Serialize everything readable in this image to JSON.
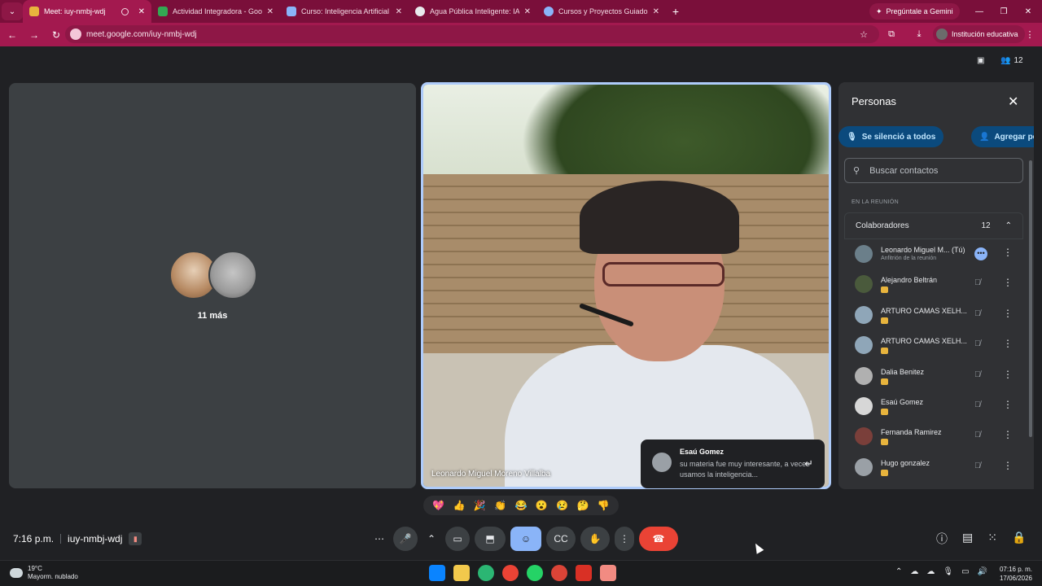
{
  "browser": {
    "tabs": [
      {
        "title": "Meet: iuy-nmbj-wdj",
        "active": true,
        "favicon_color": "#e8b43d"
      },
      {
        "title": "Actividad Integradora - Google",
        "active": false,
        "favicon_color": "#34a853"
      },
      {
        "title": "Curso: Inteligencia Artificial | p",
        "active": false,
        "favicon_color": "#8ab4f8"
      },
      {
        "title": "Agua Pública Inteligente: IA pa",
        "active": false,
        "favicon_color": "#e8eaed"
      },
      {
        "title": "Cursos y Proyectos Guiados",
        "active": false,
        "favicon_color": "#8ab4f8"
      }
    ],
    "gemini_label": "Pregúntale a Gemini",
    "url": "meet.google.com/iuy-nmbj-wdj",
    "profile_label": "Institución educativa",
    "theme_color": "#a3194f"
  },
  "meet": {
    "participant_count_badge": "12",
    "left_tile": {
      "more_label": "11 más"
    },
    "main_tile": {
      "name": "Leonardo Miguel Moreno Villalba"
    },
    "chat_popup": {
      "author": "Esaú Gomez",
      "message": "su materia fue muy interesante, a veces usamos la inteligencia..."
    },
    "people_panel": {
      "title": "Personas",
      "mute_all_label": "Se silenció a todos",
      "add_person_label": "Agregar persona",
      "search_placeholder": "Buscar contactos",
      "section_label": "EN LA REUNIÓN",
      "group_label": "Colaboradores",
      "group_count": "12",
      "participants": [
        {
          "name": "Leonardo Miguel M...  (Tú)",
          "subtitle": "Anfitrión de la reunión",
          "avatar_color": "#6b7f8a"
        },
        {
          "name": "Alejandro Beltrán",
          "subtitle": "",
          "avatar_color": "#4a5a3c"
        },
        {
          "name": "ARTURO CAMAS XELH...",
          "subtitle": "",
          "avatar_color": "#8fa6b8"
        },
        {
          "name": "ARTURO CAMAS XELH...",
          "subtitle": "",
          "avatar_color": "#8fa6b8"
        },
        {
          "name": "Dalia Benitez",
          "subtitle": "",
          "avatar_color": "#b0b0b0"
        },
        {
          "name": "Esaú Gomez",
          "subtitle": "",
          "avatar_color": "#d7d7d7"
        },
        {
          "name": "Fernanda Ramirez",
          "subtitle": "",
          "avatar_color": "#7a3f3a"
        },
        {
          "name": "Hugo gonzalez",
          "subtitle": "",
          "avatar_color": "#9aa0a6"
        }
      ]
    },
    "reactions": [
      "💖",
      "👍",
      "🎉",
      "👏",
      "😂",
      "😮",
      "😢",
      "🤔",
      "👎"
    ],
    "bottom": {
      "time": "7:16 p.m.",
      "meeting_code": "iuy-nmbj-wdj"
    }
  },
  "taskbar": {
    "temperature": "19°C",
    "weather": "Mayorm. nublado",
    "clock_time": "07:16 p. m.",
    "clock_date": "17/06/2026",
    "app_colors": [
      "#0a84ff",
      "#f2c94c",
      "#2bb673",
      "#ea4335",
      "#25d366",
      "#ea4335",
      "#d93025",
      "#f28b82"
    ]
  }
}
